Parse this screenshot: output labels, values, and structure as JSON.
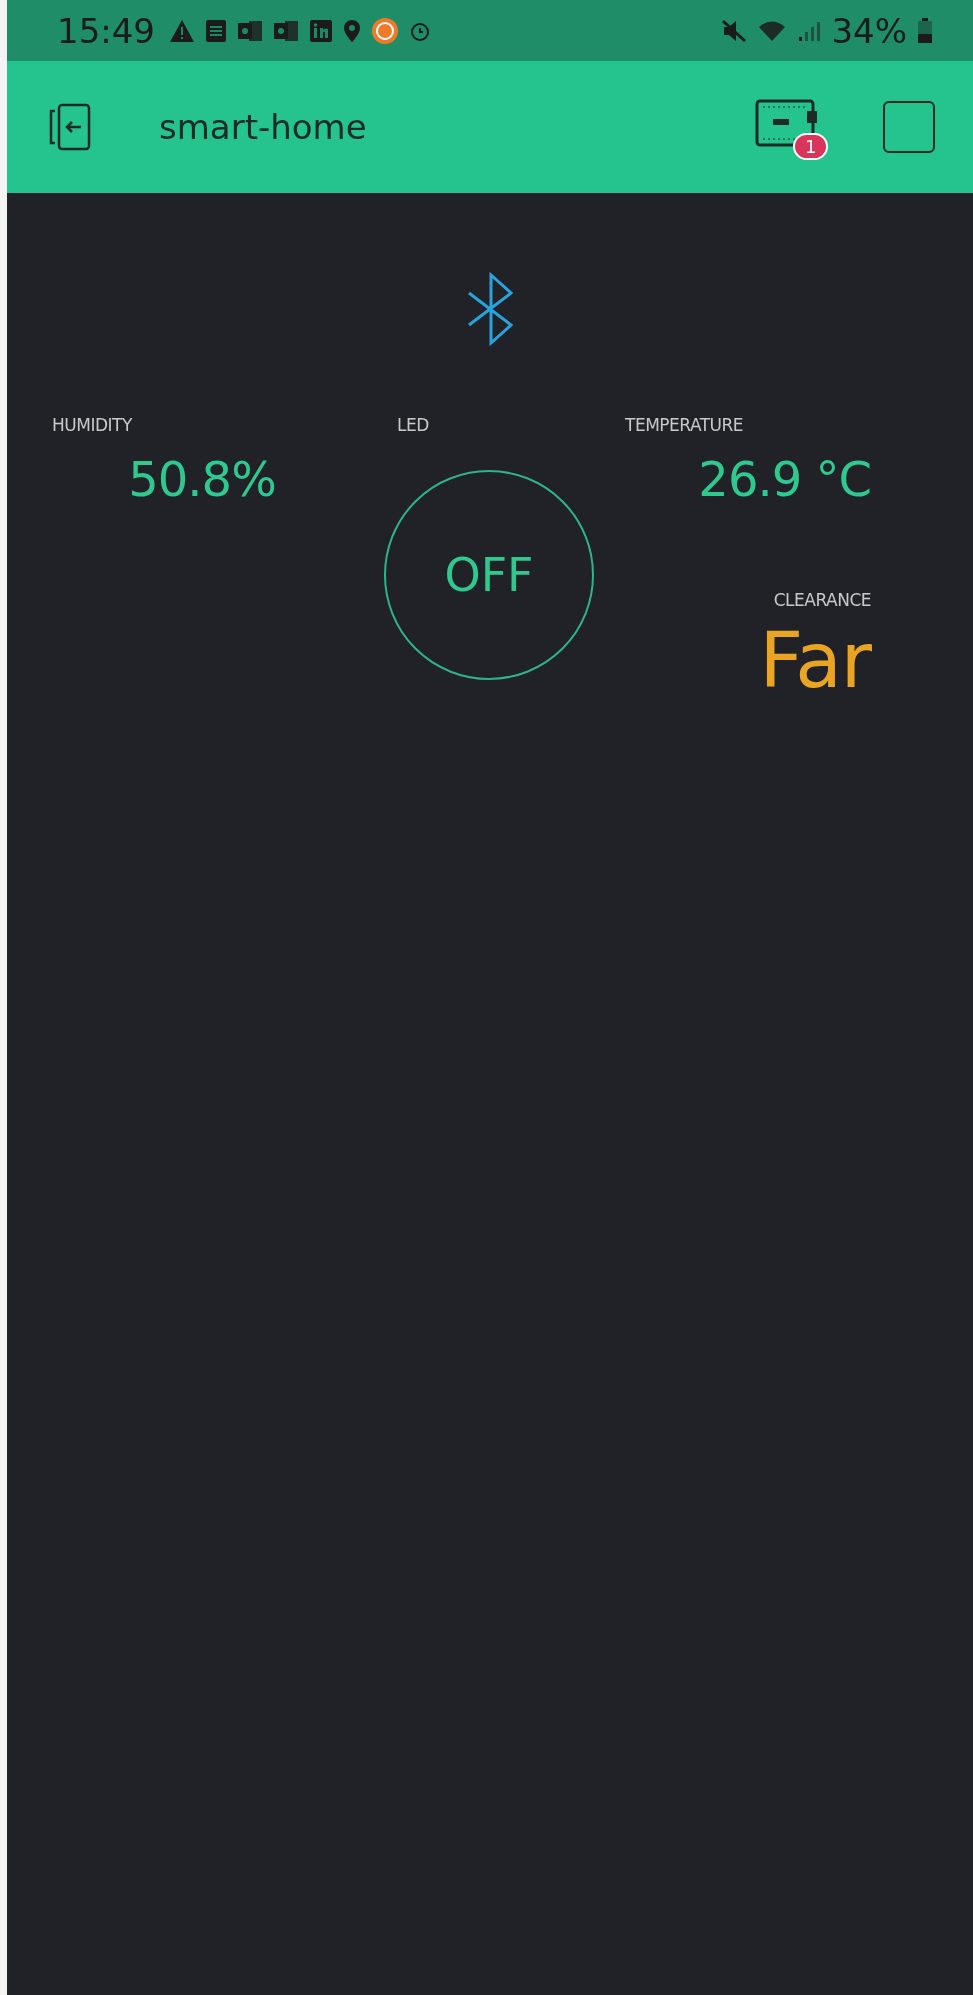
{
  "status_bar": {
    "time": "15:49",
    "battery": "34%"
  },
  "header": {
    "title": "smart-home",
    "device_badge": "1"
  },
  "widgets": [
    {
      "kind": "display",
      "label": "HUMIDITY",
      "value": "50.8%",
      "color": "#2fc88f"
    },
    {
      "kind": "button",
      "label": "LED",
      "value": "OFF",
      "on": false
    },
    {
      "kind": "display",
      "label": "TEMPERATURE",
      "value": "26.9 °C",
      "color": "#2fc88f"
    },
    {
      "kind": "display",
      "label": "CLEARANCE",
      "value": "Far",
      "color": "#eaa424"
    }
  ]
}
